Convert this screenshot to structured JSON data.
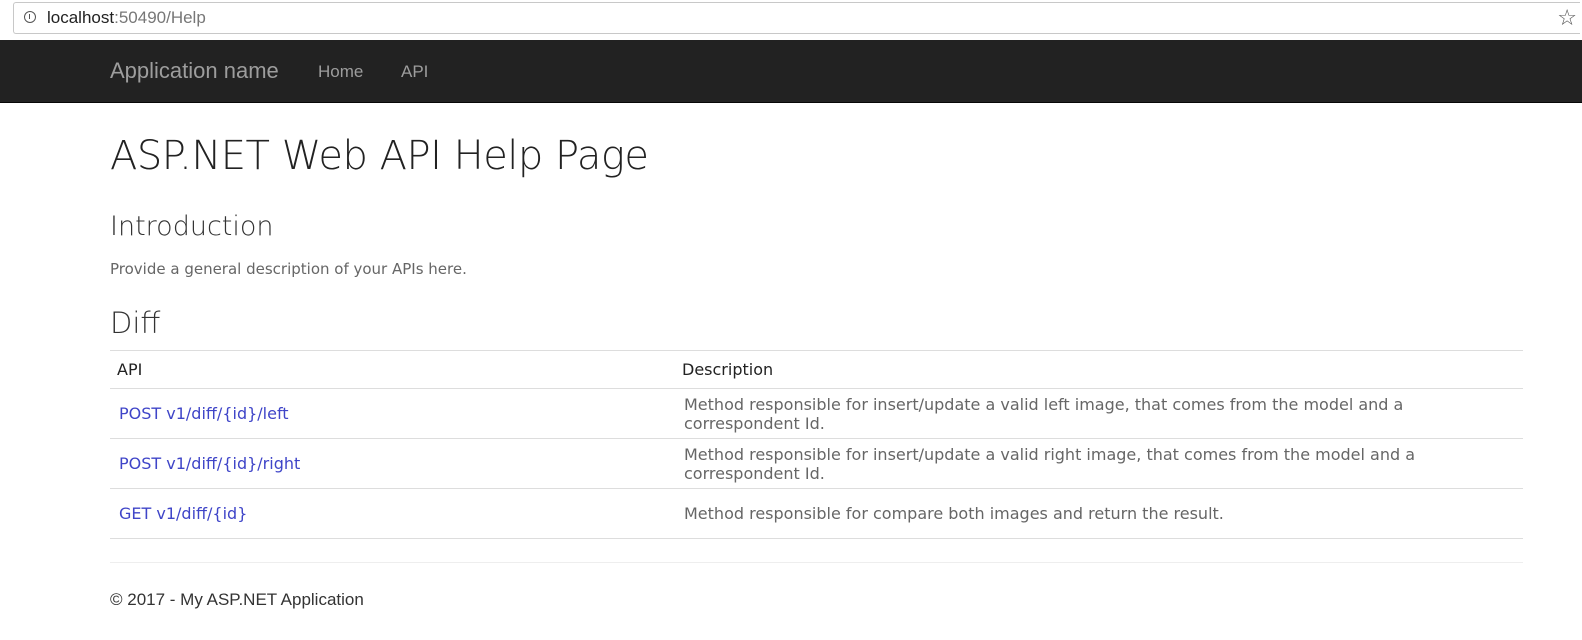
{
  "browser": {
    "url_host": "localhost",
    "url_rest": ":50490/Help",
    "star_glyph": "☆"
  },
  "navbar": {
    "brand": "Application name",
    "links": [
      "Home",
      "API"
    ]
  },
  "page": {
    "title": "ASP.NET Web API Help Page",
    "intro_heading": "Introduction",
    "intro_text": "Provide a general description of your APIs here.",
    "group_heading": "Diff",
    "table": {
      "headers": [
        "API",
        "Description"
      ],
      "rows": [
        {
          "api": "POST v1/diff/{id}/left",
          "description": "Method responsible for insert/update a valid left image, that comes from the model and a correspondent Id."
        },
        {
          "api": "POST v1/diff/{id}/right",
          "description": "Method responsible for insert/update a valid right image, that comes from the model and a correspondent Id."
        },
        {
          "api": "GET v1/diff/{id}",
          "description": "Method responsible for compare both images and return the result."
        }
      ]
    }
  },
  "footer": {
    "text": "© 2017 - My ASP.NET Application"
  },
  "colors": {
    "navbar_bg": "#222222",
    "nav_text": "#9d9d9d",
    "link": "#3f45c8"
  }
}
